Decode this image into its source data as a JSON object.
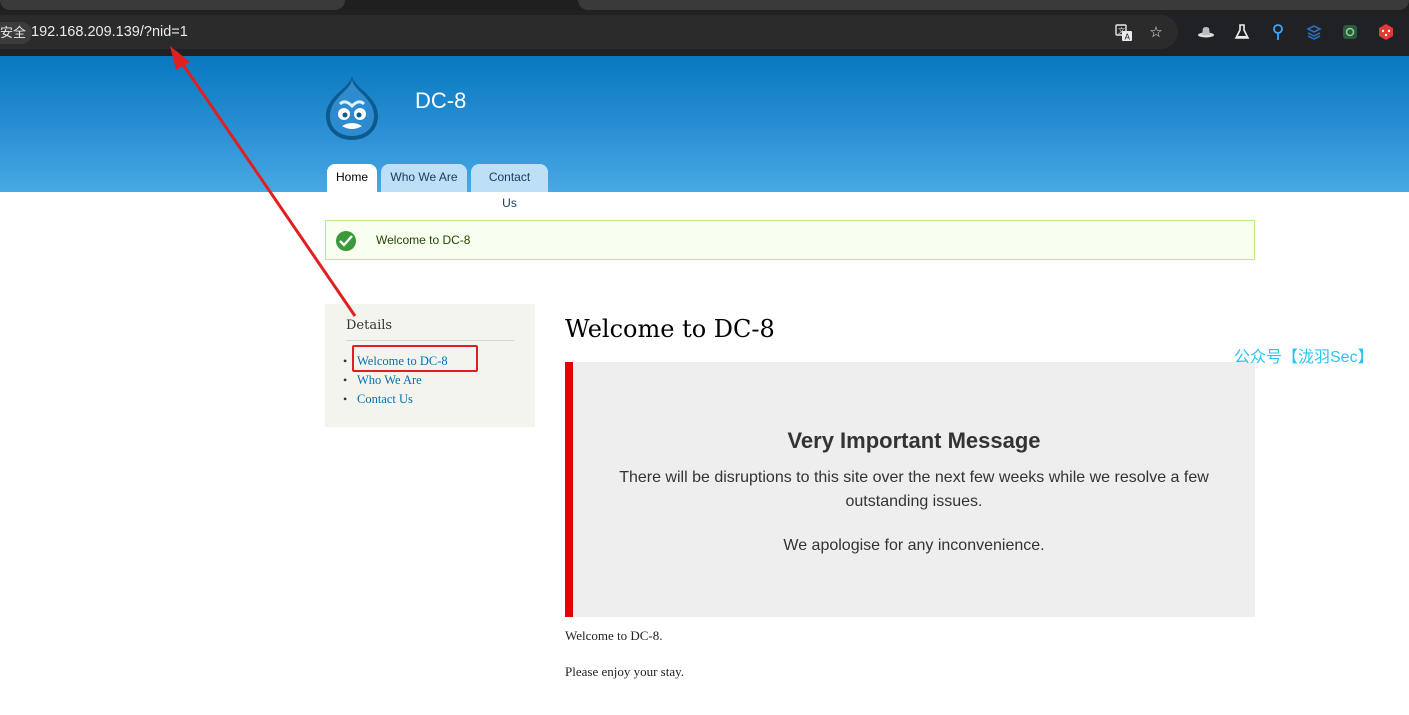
{
  "browser": {
    "security_label": "安全",
    "url": "192.168.209.139/?nid=1",
    "icons": [
      "translate-icon",
      "star-icon",
      "hat-icon",
      "flask-icon",
      "pin-icon",
      "extension-icon",
      "screen-icon",
      "dice-icon"
    ]
  },
  "site": {
    "name": "DC-8",
    "tabs": [
      {
        "label": "Home",
        "active": true
      },
      {
        "label": "Who We Are",
        "active": false
      },
      {
        "label": "Contact Us",
        "active": false
      }
    ]
  },
  "status": {
    "message": "Welcome to DC-8",
    "color": "#3a9a3a"
  },
  "sidebar": {
    "title": "Details",
    "items": [
      {
        "label": "Welcome to DC-8"
      },
      {
        "label": "Who We Are"
      },
      {
        "label": "Contact Us"
      }
    ]
  },
  "content": {
    "title": "Welcome to DC-8",
    "notice": {
      "heading": "Very Important Message",
      "line1": "There will be disruptions to this site over the next few weeks while we resolve a few outstanding issues.",
      "line2": "We apologise for any inconvenience."
    },
    "body1": "Welcome to DC-8.",
    "body2": "Please enjoy your stay."
  },
  "annotation": {
    "watermark": "公众号【泷羽Sec】",
    "highlight_color": "#e02020"
  }
}
